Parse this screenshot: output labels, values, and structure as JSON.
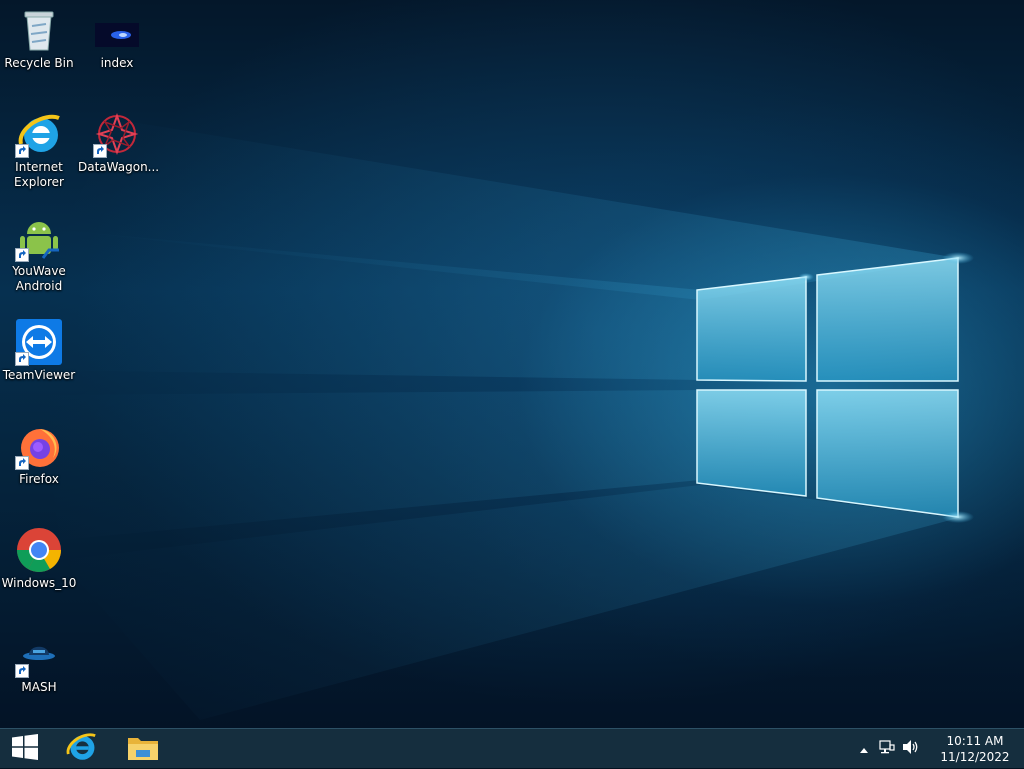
{
  "desktop": {
    "icons": [
      {
        "label": "Recycle Bin",
        "icon": "recycle-bin-icon"
      },
      {
        "label": "index",
        "icon": "index-file-icon"
      },
      {
        "label": "Internet Explorer",
        "icon": "internet-explorer-icon"
      },
      {
        "label": "DataWagon...",
        "icon": "datawagon-icon"
      },
      {
        "label": "YouWave Android",
        "icon": "android-icon"
      },
      {
        "label": "TeamViewer",
        "icon": "teamviewer-icon"
      },
      {
        "label": "Firefox",
        "icon": "firefox-icon"
      },
      {
        "label": "Windows_10",
        "icon": "chrome-icon"
      },
      {
        "label": "MASH",
        "icon": "mash-icon"
      }
    ]
  },
  "taskbar": {
    "pinned": [
      {
        "name": "start-button",
        "icon": "windows-logo-icon"
      },
      {
        "name": "internet-explorer",
        "icon": "internet-explorer-icon"
      },
      {
        "name": "file-explorer",
        "icon": "folder-icon"
      }
    ],
    "tray": {
      "show_hidden_icon": "chevron-up-icon",
      "network_icon": "network-icon",
      "volume_icon": "volume-icon"
    },
    "clock": {
      "time": "10:11 AM",
      "date": "11/12/2022"
    }
  },
  "colors": {
    "wallpaper_accent": "#3fb6e6",
    "taskbar": "#163040"
  }
}
